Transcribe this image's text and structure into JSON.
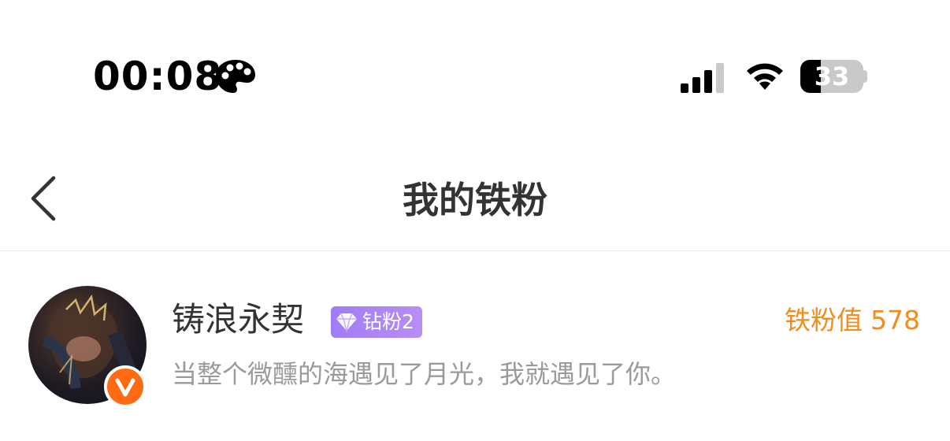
{
  "status_bar": {
    "time": "00:08",
    "battery_level": 33,
    "battery_label": "33",
    "icons": [
      "palette-icon",
      "cellular-signal-icon",
      "wifi-icon",
      "battery-icon"
    ]
  },
  "nav": {
    "title": "我的铁粉",
    "back_icon": "chevron-left-icon"
  },
  "fans": [
    {
      "name": "铸浪永契",
      "badge_icon": "diamond-icon",
      "badge_label": "钻粉2",
      "signature": "当整个微醺的海遇见了月光，我就遇见了你。",
      "score_label": "铁粉值",
      "score_value": "578",
      "verified_icon": "v-verified-icon"
    }
  ],
  "colors": {
    "accent_orange": "#f08d1d",
    "badge_purple": "#a07cf7",
    "verified_orange": "#ff6a13",
    "secondary_text": "#9a9a9a"
  }
}
